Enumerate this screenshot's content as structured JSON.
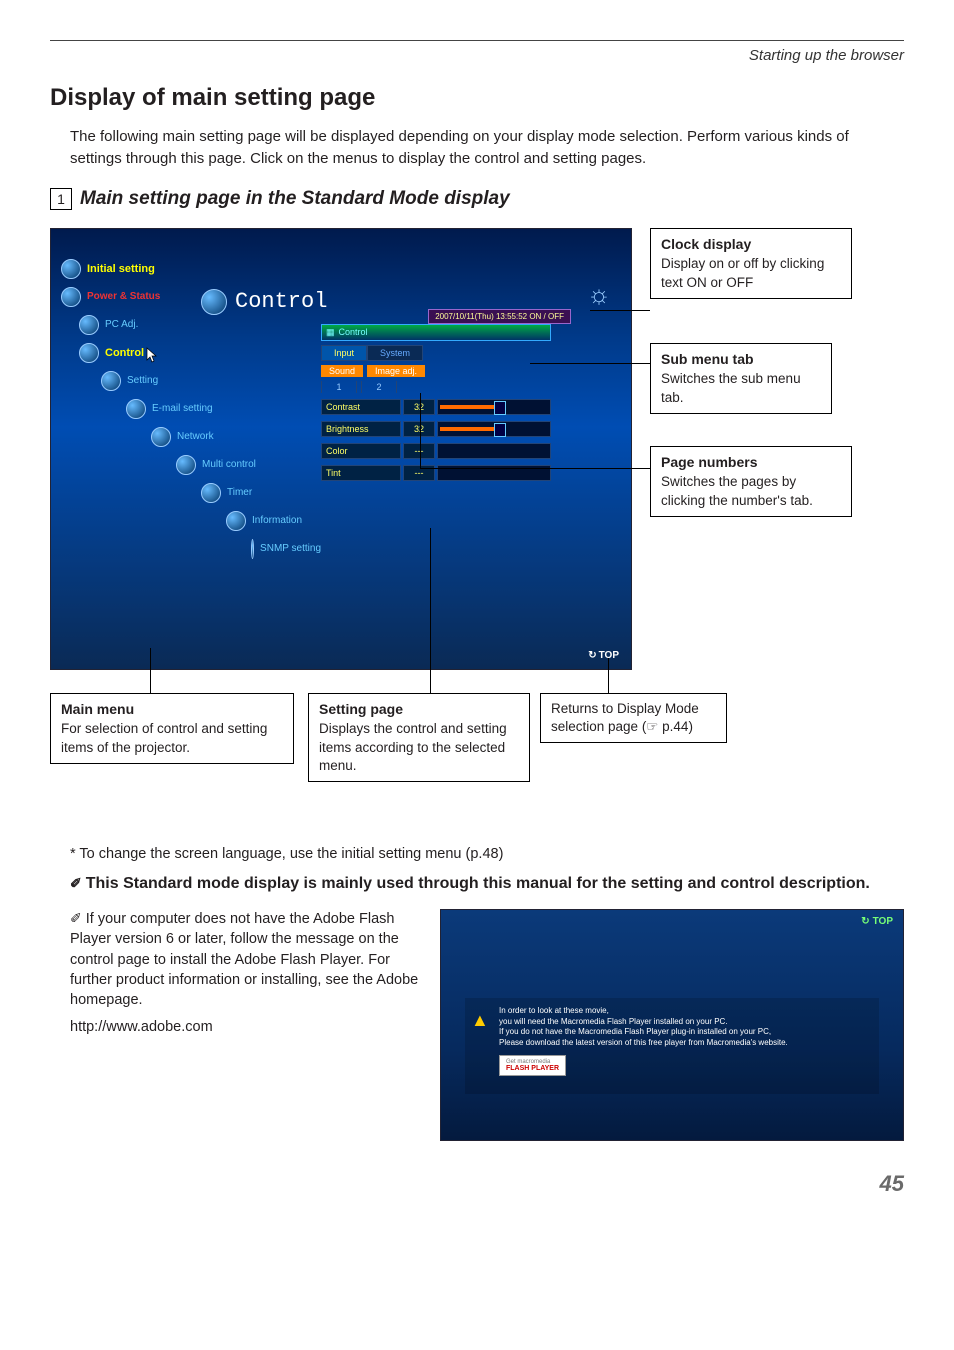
{
  "header": {
    "section": "Starting up the browser"
  },
  "title": "Display of main setting page",
  "intro": "The following main setting page will be displayed depending on your display mode selection. Perform various kinds of settings through this page. Click on the menus to display the control and setting pages.",
  "subsection": {
    "num": "1",
    "text": "Main setting page in the Standard Mode display"
  },
  "screenshot": {
    "title_icon": "control-icon",
    "title_text": "Control",
    "timestamp": "2007/10/11(Thu) 13:55:52  ON / OFF",
    "menu": {
      "items": [
        {
          "label": "Initial setting",
          "style": "yellow",
          "indent": 0
        },
        {
          "label": "Power & Status",
          "style": "power",
          "indent": 0
        },
        {
          "label": "PC Adj.",
          "style": "blue",
          "indent": 1
        },
        {
          "label": "Control",
          "style": "yellow",
          "indent": 1,
          "cursor": true
        },
        {
          "label": "Setting",
          "style": "blue",
          "indent": 2
        },
        {
          "label": "E-mail setting",
          "style": "blue",
          "indent": 3
        },
        {
          "label": "Network",
          "style": "blue",
          "indent": 4
        },
        {
          "label": "Multi control",
          "style": "blue",
          "indent": 5
        },
        {
          "label": "Timer",
          "style": "blue",
          "indent": 6
        },
        {
          "label": "Information",
          "style": "blue",
          "indent": 7
        },
        {
          "label": "SNMP setting",
          "style": "blue",
          "indent": 8
        }
      ]
    },
    "panel": {
      "head": "Control",
      "tabs": [
        {
          "label": "Input",
          "active": true
        },
        {
          "label": "System",
          "active": false
        }
      ],
      "subtabs": [
        "Sound",
        "Image adj."
      ],
      "pagenums": [
        "1",
        "2"
      ],
      "rows": [
        {
          "label": "Contrast",
          "value": "32",
          "fill": 50
        },
        {
          "label": "Brightness",
          "value": "32",
          "fill": 50
        },
        {
          "label": "Color",
          "value": "---",
          "fill": 0
        },
        {
          "label": "Tint",
          "value": "---",
          "fill": 0
        }
      ]
    },
    "top_link": "TOP"
  },
  "callouts": {
    "clock": {
      "title": "Clock display",
      "body": "Display on or off by clicking text ON or OFF"
    },
    "submenu": {
      "title": "Sub menu tab",
      "body": "Switches the sub menu tab."
    },
    "pages": {
      "title": "Page numbers",
      "body": "Switches the pages by clicking the number's tab."
    },
    "mainmenu": {
      "title": "Main menu",
      "body": "For selection of  control and setting items of the projector."
    },
    "setting": {
      "title": "Setting page",
      "body": "Displays the control and setting items according to the selected menu."
    },
    "returns": {
      "body": "Returns to Display Mode selection page (☞ p.44)"
    }
  },
  "footnote": "* To change the screen language, use the initial setting menu (p.48)",
  "emph_note": "This Standard mode display is mainly used through this manual for the setting and control description.",
  "flash_note": {
    "text": "If your computer does not have the Adobe Flash Player version 6 or later, follow the message on the control page to install the Adobe Flash Player. For further product information or installing, see the Adobe homepage.",
    "url": "http://www.adobe.com"
  },
  "warning_shot": {
    "top": "TOP",
    "lines": [
      "In order to look at these movie,",
      "you will need the Macromedia Flash Player installed on your PC.",
      "If you do not have the Macromedia Flash Player plug-in installed on your PC,",
      "Please download the latest version of this free player from Macromedia's website."
    ],
    "button": {
      "get": "Get macromedia",
      "name": "FLASH PLAYER"
    }
  },
  "page_number": "45"
}
